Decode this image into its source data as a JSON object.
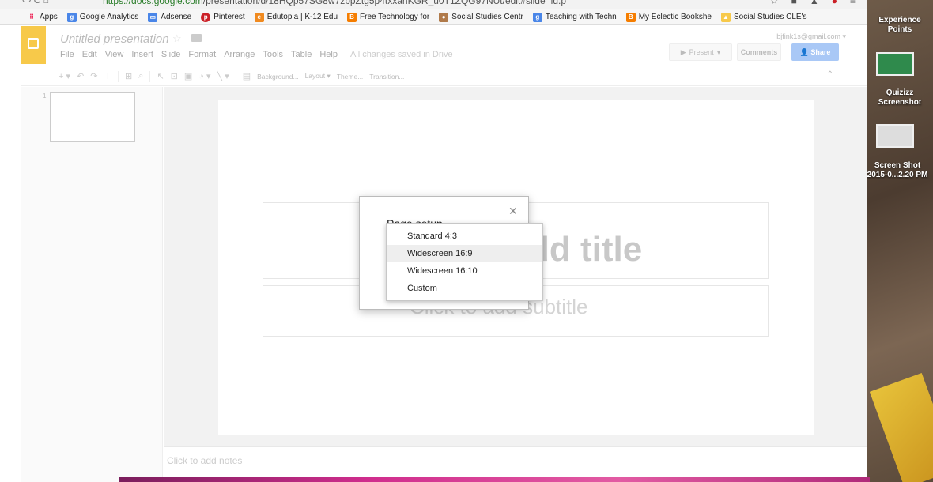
{
  "browser": {
    "url_secure": "https://docs.google.com",
    "url_rest": "/presentation/d/18HQp57SG8w7zbpZtg5p4txxanKGR_u0T1ZQG97NUt/edit#slide=id.p",
    "bookmarks": [
      {
        "label": "Apps",
        "icon": "apps-grid-icon",
        "color": "#e25"
      },
      {
        "label": "Google Analytics",
        "icon": "google-icon",
        "color": "#4a86e8"
      },
      {
        "label": "Adsense",
        "icon": "adsense-icon",
        "color": "#4a86e8"
      },
      {
        "label": "Pinterest",
        "icon": "pinterest-icon",
        "color": "#cb2027"
      },
      {
        "label": "Edutopia | K-12 Edu",
        "icon": "edutopia-icon",
        "color": "#f08a1f"
      },
      {
        "label": "Free Technology for",
        "icon": "blogger-icon",
        "color": "#f57d00"
      },
      {
        "label": "Social Studies Centr",
        "icon": "person-icon",
        "color": "#b07a4a"
      },
      {
        "label": "Teaching with Techn",
        "icon": "google-icon",
        "color": "#4a86e8"
      },
      {
        "label": "My Eclectic Bookshe",
        "icon": "blogger-icon",
        "color": "#f57d00"
      },
      {
        "label": "Social Studies CLE's",
        "icon": "drive-icon",
        "color": "#f7c94a"
      }
    ]
  },
  "app": {
    "doc_title": "Untitled presentation",
    "menu": [
      "File",
      "Edit",
      "View",
      "Insert",
      "Slide",
      "Format",
      "Arrange",
      "Tools",
      "Table",
      "Help"
    ],
    "saved_status": "All changes saved in Drive",
    "account_email": "bjfink1s@gmail.com",
    "present_label": "Present",
    "comments_label": "Comments",
    "share_label": "Share",
    "toolbar": {
      "background_label": "Background...",
      "layout_label": "Layout",
      "theme_label": "Theme...",
      "transition_label": "Transition..."
    },
    "slide_number": "1",
    "title_placeholder": "dd title",
    "subtitle_placeholder": "Click to add subtitle",
    "notes_placeholder": "Click to add notes"
  },
  "dialog": {
    "title": "Page setup",
    "options": [
      "Standard 4:3",
      "Widescreen 16:9",
      "Widescreen 16:10",
      "Custom"
    ],
    "selected": "Widescreen 16:9"
  },
  "desktop": {
    "icons": [
      {
        "label_line1": "Experience",
        "label_line2": "Points"
      },
      {
        "label_line1": "Quizizz",
        "label_line2": "Screenshot"
      },
      {
        "label_line1": "Screen Shot",
        "label_line2": "2015-0...2.20 PM"
      }
    ]
  },
  "colors": {
    "accent": "#f7c94a",
    "share_button": "#a9c8f6",
    "selection": "#eeeeee"
  }
}
